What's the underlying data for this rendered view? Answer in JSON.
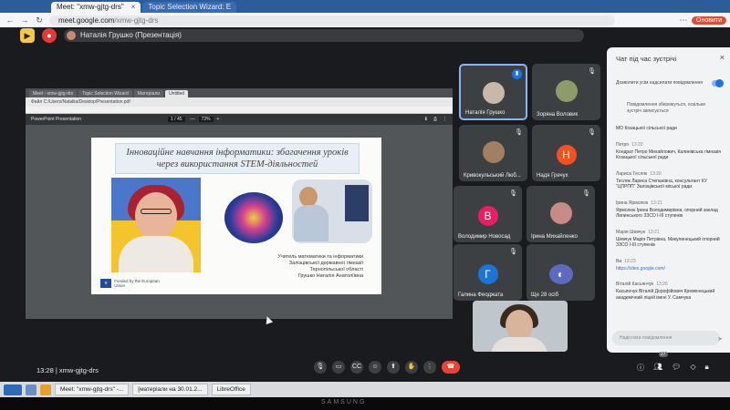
{
  "browser": {
    "tabs": [
      {
        "label": "Meet: \"xmw-gjtg-drs\"",
        "active": true
      },
      {
        "label": "Topic Selection Wizard: E",
        "active": false
      }
    ],
    "url_host": "meet.google.com",
    "url_path": "/xmw-gjtg-drs",
    "update_label": "Оновити"
  },
  "meet": {
    "presenter_label": "Наталія Грушко (Презентація)",
    "meeting_time": "13:28",
    "meeting_code": "xmw-gjtg-drs",
    "participant_count": "27"
  },
  "share": {
    "pdf_title": "PowerPoint Presentation",
    "page": "1 / 45",
    "zoom": "73%",
    "slide_title": "Інноваційне навчання інформатики: збагачення уроків через використання STEM-діяльностей",
    "caption_lines": [
      "Учитель математики та інформатики",
      "Залізцівської державної гімназії",
      "Тернопільської області",
      "Грушко Наталія Анатоліївна"
    ],
    "eu_label": "Funded by the European Union"
  },
  "participants": [
    {
      "name": "Наталія Грушко",
      "avatar": "photo",
      "color": "#c9b8a8",
      "speaking": true
    },
    {
      "name": "Зоряна Воловик",
      "avatar": "photo",
      "color": "#8d9b6a",
      "speaking": false
    },
    {
      "name": "Кривокульський Люб...",
      "avatar": "photo",
      "color": "#a08060",
      "speaking": false
    },
    {
      "name": "Надя Гречух",
      "avatar": "letter",
      "letter": "Н",
      "color": "#f4511e",
      "speaking": false
    },
    {
      "name": "Володимир Новосад",
      "avatar": "letter",
      "letter": "В",
      "color": "#e91e63",
      "speaking": false
    },
    {
      "name": "Ірина Михайленко",
      "avatar": "photo",
      "color": "#c78a86",
      "speaking": false
    },
    {
      "name": "Галина Феоджата",
      "avatar": "letter",
      "letter": "Г",
      "color": "#1976d2",
      "speaking": false
    },
    {
      "name": "Ще 28 осіб",
      "avatar": "group",
      "color": "#3c4043",
      "speaking": false
    }
  ],
  "chat": {
    "title": "Чат під час зустрічі",
    "toggle_text": "Дозволити усім надсилати повідомлення",
    "notice": "Повідомлення збережуться, оскільки зустріч записується",
    "messages": [
      {
        "author": "",
        "time": "",
        "text": "МО Козацької сільської ради"
      },
      {
        "author": "Петро",
        "time": "13:20",
        "text": "Кондрат Петро Михайлович, Калинівська гімназія Козацької сільської ради"
      },
      {
        "author": "Лариса Тесляк",
        "time": "13:20",
        "text": "Тесляк Лариса Степанівна, консультант КУ \"ЦПРПП\" Залізцівської міської ради"
      },
      {
        "author": "Ірина Ярмолюк",
        "time": "13:21",
        "text": "Ярмолюк Ірина Володимирівна, опорний заклад Липинського ЗЗСО І-ІІІ ступенів"
      },
      {
        "author": "Марія Шевчук",
        "time": "13:21",
        "text": "Шевчук Марія Петрівна, Микулинецький опорний ЗЗСО І-ІІІ ступенів"
      },
      {
        "author": "Ви",
        "time": "13:23",
        "text": "https://sites.google.com/"
      },
      {
        "author": "Віталій Касьянчук",
        "time": "13:26",
        "text": "Касьянчук Віталій Дорофійович Кременецький академічний ліцей імені У. Самчука"
      }
    ],
    "input_placeholder": "Надіслати повідомлення"
  },
  "taskbar": {
    "items": [
      "Meet: \"xmw-gjtg-drs\" -...",
      "[матеріали на 30.01.2...",
      "LibreOffice"
    ]
  },
  "bezel_brand": "SAMSUNG"
}
